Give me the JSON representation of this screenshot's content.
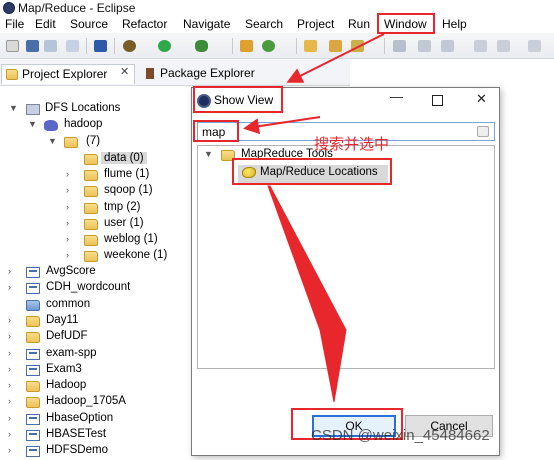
{
  "window": {
    "title": "Map/Reduce - Eclipse"
  },
  "menu": [
    "File",
    "Edit",
    "Source",
    "Refactor",
    "Navigate",
    "Search",
    "Project",
    "Run",
    "Window",
    "Help"
  ],
  "view_tabs": [
    {
      "label": "Project Explorer"
    },
    {
      "label": "Package Explorer"
    }
  ],
  "tree": {
    "dfs_locations": "DFS Locations",
    "hadoop_node": "hadoop",
    "count_node": "(7)",
    "folders": [
      "data (0)",
      "flume (1)",
      "sqoop (1)",
      "tmp (2)",
      "user (1)",
      "weblog (1)",
      "weekone (1)"
    ],
    "projects": [
      "AvgScore",
      "CDH_wordcount",
      "common",
      "Day11",
      "DefUDF",
      "exam-spp",
      "Exam3",
      "Hadoop",
      "Hadoop_1705A",
      "HbaseOption",
      "HBASETest",
      "HDFSDemo"
    ]
  },
  "dialog": {
    "title": "Show View",
    "search_value": "map",
    "category": "MapReduce Tools",
    "item": "Map/Reduce Locations",
    "ok_label": "OK",
    "cancel_label": "Cancel"
  },
  "annotation": {
    "text": "搜索并选中"
  },
  "watermark": "CSDN @weixin_45484662",
  "colors": {
    "annotation": "#e8272d",
    "selection": "#d9d9d9",
    "focus": "#2a6fd6"
  }
}
